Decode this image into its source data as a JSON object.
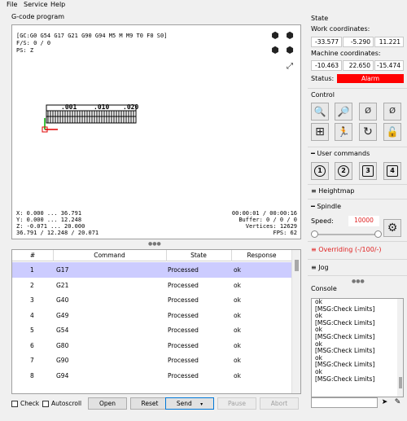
{
  "menu": [
    "File",
    "Service",
    "Help"
  ],
  "gcode": {
    "title": "G-code program",
    "state_line": "[GC:G0 G54 G17 G21 G90 G94 M5 M M9 T0 F0 S0]",
    "fs_line": "F/S: 0 / 0",
    "ps_line": "PS: Z",
    "x_range": "X: 0.000 ... 36.791",
    "y_range": "Y: 0.000 ... 12.248",
    "z_range": "Z: -0.071 ... 20.000",
    "size_line": "36.791 / 12.248 / 20.071",
    "time": "00:00:01 / 00:00:16",
    "buffer": "Buffer: 0 / 0 / 0",
    "vertices": "Vertices: 12629",
    "fps": "FPS: 62",
    "drawing_labels": [
      ".001",
      ".010",
      ".020"
    ]
  },
  "table": {
    "headers": [
      "#",
      "Command",
      "State",
      "Response"
    ],
    "rows": [
      {
        "n": "1",
        "cmd": "G17",
        "state": "Processed",
        "resp": "ok",
        "selected": true
      },
      {
        "n": "2",
        "cmd": "G21",
        "state": "Processed",
        "resp": "ok"
      },
      {
        "n": "3",
        "cmd": "G40",
        "state": "Processed",
        "resp": "ok"
      },
      {
        "n": "4",
        "cmd": "G49",
        "state": "Processed",
        "resp": "ok"
      },
      {
        "n": "5",
        "cmd": "G54",
        "state": "Processed",
        "resp": "ok"
      },
      {
        "n": "6",
        "cmd": "G80",
        "state": "Processed",
        "resp": "ok"
      },
      {
        "n": "7",
        "cmd": "G90",
        "state": "Processed",
        "resp": "ok"
      },
      {
        "n": "8",
        "cmd": "G94",
        "state": "Processed",
        "resp": "ok"
      }
    ]
  },
  "bottom": {
    "check": "Check",
    "autoscroll": "Autoscroll",
    "open": "Open",
    "reset": "Reset",
    "send": "Send",
    "pause": "Pause",
    "abort": "Abort"
  },
  "state": {
    "title": "State",
    "work_label": "Work coordinates:",
    "work": [
      "-33.577",
      "-5.290",
      "11.221"
    ],
    "machine_label": "Machine coordinates:",
    "machine": [
      "-10.463",
      "22.650",
      "-15.474"
    ],
    "status_label": "Status:",
    "status": "Alarm",
    "status_color": "#ff0000"
  },
  "control": {
    "title": "Control",
    "icons": [
      "home-search-icon",
      "zoom-search-icon",
      "zero-z-icon",
      "zero-xy-icon",
      "origin-icon",
      "safe-position-icon",
      "restore-icon",
      "unlock-icon"
    ]
  },
  "user_commands": {
    "title": "User commands",
    "buttons": [
      "1",
      "2",
      "3",
      "4"
    ]
  },
  "heightmap": {
    "title": "Heightmap"
  },
  "spindle": {
    "title": "Spindle",
    "speed_label": "Speed:",
    "speed": "10000",
    "slider_level": 1.0
  },
  "overriding": {
    "title": "Overriding (-/100/-)",
    "color": "#e02020"
  },
  "jog": {
    "title": "Jog"
  },
  "console": {
    "title": "Console",
    "lines": [
      "ok",
      "[MSG:Check Limits]",
      "ok",
      "[MSG:Check Limits]",
      "ok",
      "[MSG:Check Limits]",
      "ok",
      "[MSG:Check Limits]",
      "ok",
      "[MSG:Check Limits]",
      "ok",
      "[MSG:Check Limits]"
    ]
  }
}
